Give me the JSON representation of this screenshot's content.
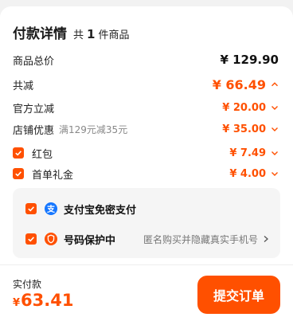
{
  "header": {
    "title": "付款详情",
    "count_prefix": "共",
    "count": "1",
    "count_suffix": "件商品"
  },
  "rows": {
    "total": {
      "label": "商品总价",
      "amount": "¥ 129.90"
    },
    "discount_total": {
      "label": "共减",
      "amount": "¥ 66.49",
      "icon": "chevron-up-icon"
    },
    "official": {
      "label": "官方立减",
      "amount": "¥ 20.00",
      "icon": "chevron-down-icon"
    },
    "store": {
      "label": "店铺优惠",
      "note": "满129元减35元",
      "amount": "¥ 35.00",
      "icon": "chevron-down-icon"
    },
    "red_packet": {
      "label": "红包",
      "amount": "¥ 7.49",
      "checked": true,
      "icon": "chevron-down-icon"
    },
    "first_order": {
      "label": "首单礼金",
      "amount": "¥ 4.00",
      "checked": true,
      "icon": "chevron-down-icon"
    }
  },
  "options": {
    "alipay": {
      "label": "支付宝免密支付",
      "icon": "alipay-icon",
      "checked": true
    },
    "privacy": {
      "label": "号码保护中",
      "hint": "匿名购买并隐藏真实手机号",
      "icon": "shield-icon",
      "checked": true
    }
  },
  "footer": {
    "pay_label": "实付款",
    "currency": "¥",
    "pay_amount": "63.41",
    "submit_label": "提交订单"
  },
  "colors": {
    "accent": "#ff5000",
    "alipay_blue": "#1677ff",
    "panel_bg": "#f5f5f5"
  }
}
